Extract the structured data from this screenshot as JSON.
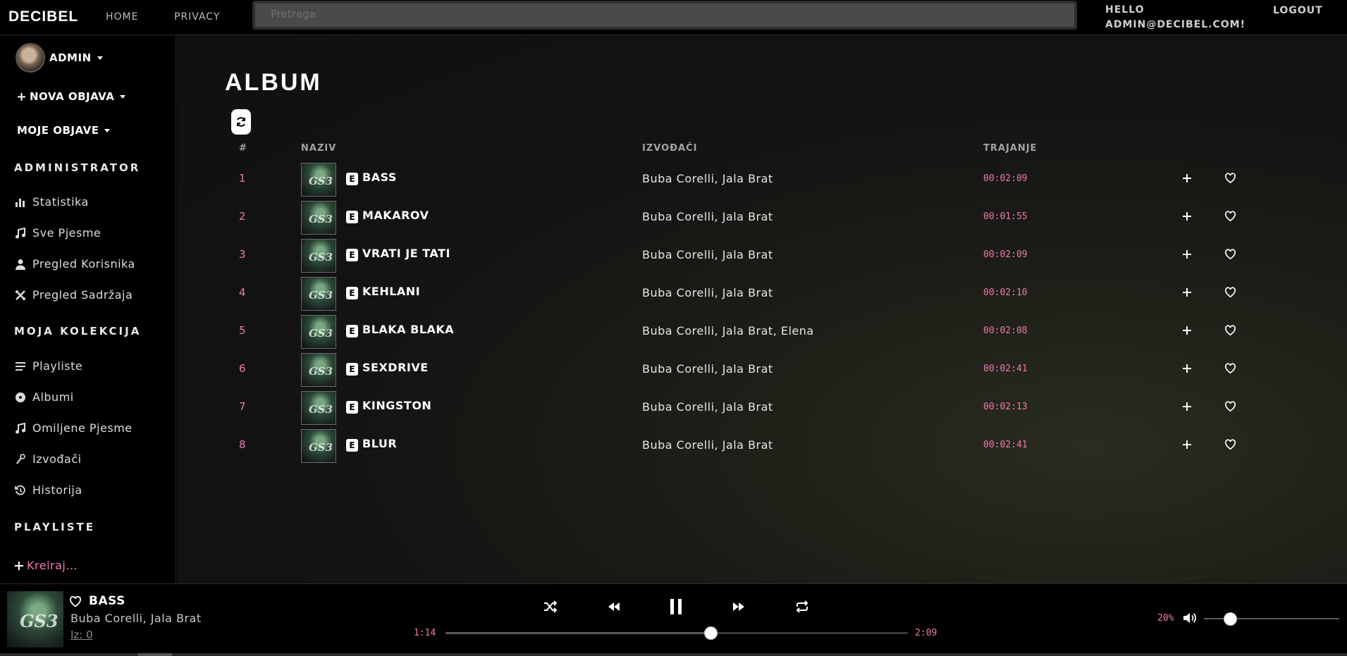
{
  "topbar": {
    "brand": "DECIBEL",
    "nav": [
      "HOME",
      "PRIVACY"
    ],
    "search_placeholder": "Pretraga",
    "hello_line1": "HELLO",
    "hello_line2": "ADMIN@DECIBEL.COM!",
    "logout": "LOGOUT"
  },
  "sidebar": {
    "profile_name": "ADMIN",
    "new_post": "NOVA OBJAVA",
    "my_posts": "MOJE OBJAVE",
    "sections": {
      "admin": "ADMINISTRATOR",
      "collection": "MOJA KOLEKCIJA",
      "playlists": "PLAYLISTE"
    },
    "admin_items": [
      {
        "label": "Statistika",
        "icon": "bar-chart-icon"
      },
      {
        "label": "Sve Pjesme",
        "icon": "music-note-icon"
      },
      {
        "label": "Pregled Korisnika",
        "icon": "user-icon"
      },
      {
        "label": "Pregled Sadržaja",
        "icon": "tools-icon"
      }
    ],
    "collection_items": [
      {
        "label": "Playliste",
        "icon": "list-icon"
      },
      {
        "label": "Albumi",
        "icon": "disc-icon"
      },
      {
        "label": "Omiljene Pjesme",
        "icon": "music-note-icon"
      },
      {
        "label": "Izvođači",
        "icon": "microphone-icon"
      },
      {
        "label": "Historija",
        "icon": "history-icon"
      }
    ],
    "create_playlist": "Kreiraj..."
  },
  "main": {
    "title": "ALBUM",
    "columns": {
      "num": "#",
      "name": "NAZIV",
      "artists": "IZVOĐAČI",
      "duration": "TRAJANJE"
    },
    "explicit_badge": "E",
    "tracks": [
      {
        "num": "1",
        "title": "BASS",
        "artists": "Buba Corelli, Jala Brat",
        "duration": "00:02:09"
      },
      {
        "num": "2",
        "title": "MAKAROV",
        "artists": "Buba Corelli, Jala Brat",
        "duration": "00:01:55"
      },
      {
        "num": "3",
        "title": "VRATI JE TATI",
        "artists": "Buba Corelli, Jala Brat",
        "duration": "00:02:09"
      },
      {
        "num": "4",
        "title": "KEHLANI",
        "artists": "Buba Corelli, Jala Brat",
        "duration": "00:02:10"
      },
      {
        "num": "5",
        "title": "BLAKA BLAKA",
        "artists": "Buba Corelli, Jala Brat, Elena",
        "duration": "00:02:08"
      },
      {
        "num": "6",
        "title": "SEXDRIVE",
        "artists": "Buba Corelli, Jala Brat",
        "duration": "00:02:41"
      },
      {
        "num": "7",
        "title": "KINGSTON",
        "artists": "Buba Corelli, Jala Brat",
        "duration": "00:02:13"
      },
      {
        "num": "8",
        "title": "BLUR",
        "artists": "Buba Corelli, Jala Brat",
        "duration": "00:02:41"
      }
    ]
  },
  "player": {
    "title": "BASS",
    "artists": "Buba Corelli, Jala Brat",
    "from": "Iz: 0",
    "current_time": "1:14",
    "total_time": "2:09",
    "progress": 0.574,
    "volume_label": "20%",
    "volume": 0.2
  },
  "colors": {
    "accent": "#ef7ab1",
    "background": "#000000"
  }
}
